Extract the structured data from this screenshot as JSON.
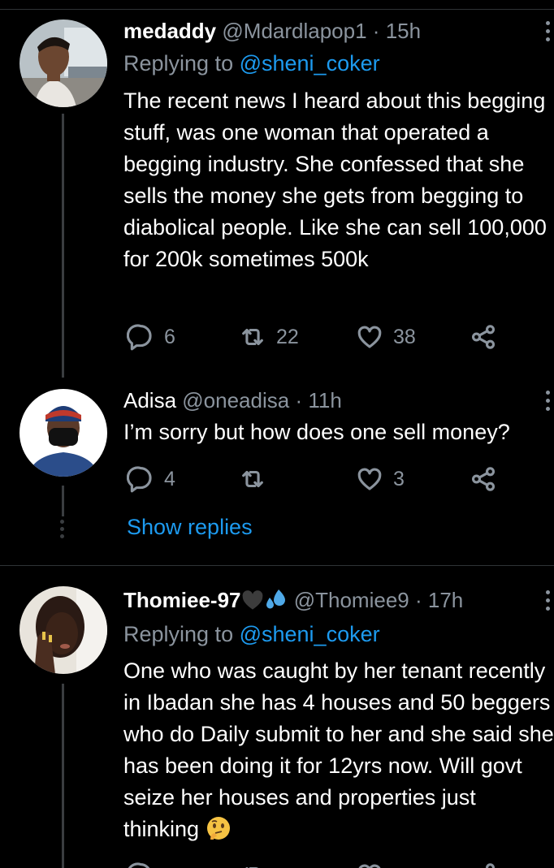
{
  "tweets": [
    {
      "name": "medaddy",
      "handle": "@Mdardlapop1",
      "time": "15h",
      "replying_prefix": "Replying to ",
      "replying_to": "@sheni_coker",
      "text": "The recent news I heard about this begging stuff, was one woman that operated a begging industry. She confessed that she sells the money she gets from begging to diabolical people. Like she can sell 100,000 for 200k sometimes 500k",
      "replies": "6",
      "retweets": "22",
      "likes": "38"
    },
    {
      "name": "Adisa",
      "handle": "@oneadisa",
      "time": "11h",
      "text": "I’m sorry but how does one sell money?",
      "replies": "4",
      "retweets": "",
      "likes": "3",
      "show_replies": "Show replies"
    },
    {
      "name": "Thomiee-97",
      "handle": "@Thomiee9",
      "time": "17h",
      "replying_prefix": "Replying to ",
      "replying_to": "@sheni_coker",
      "text": "One who was caught by her tenant recently in Ibadan she has 4 houses and 50 beggers who do Daily submit to her and she said she has been doing it for 12yrs now. Will govt seize her houses and properties just thinking"
    }
  ],
  "separator": "·",
  "icons": {
    "reply": "reply-icon",
    "retweet": "retweet-icon",
    "like": "heart-icon",
    "share": "share-icon",
    "more": "more-vertical-icon",
    "black_heart": "black-heart-emoji",
    "sweat": "sweat-droplets-emoji",
    "thinking": "thinking-face-emoji"
  },
  "colors": {
    "background": "#000000",
    "text": "#ffffff",
    "secondary": "#8b949e",
    "link": "#1d9bf0",
    "divider": "#2f3336"
  }
}
